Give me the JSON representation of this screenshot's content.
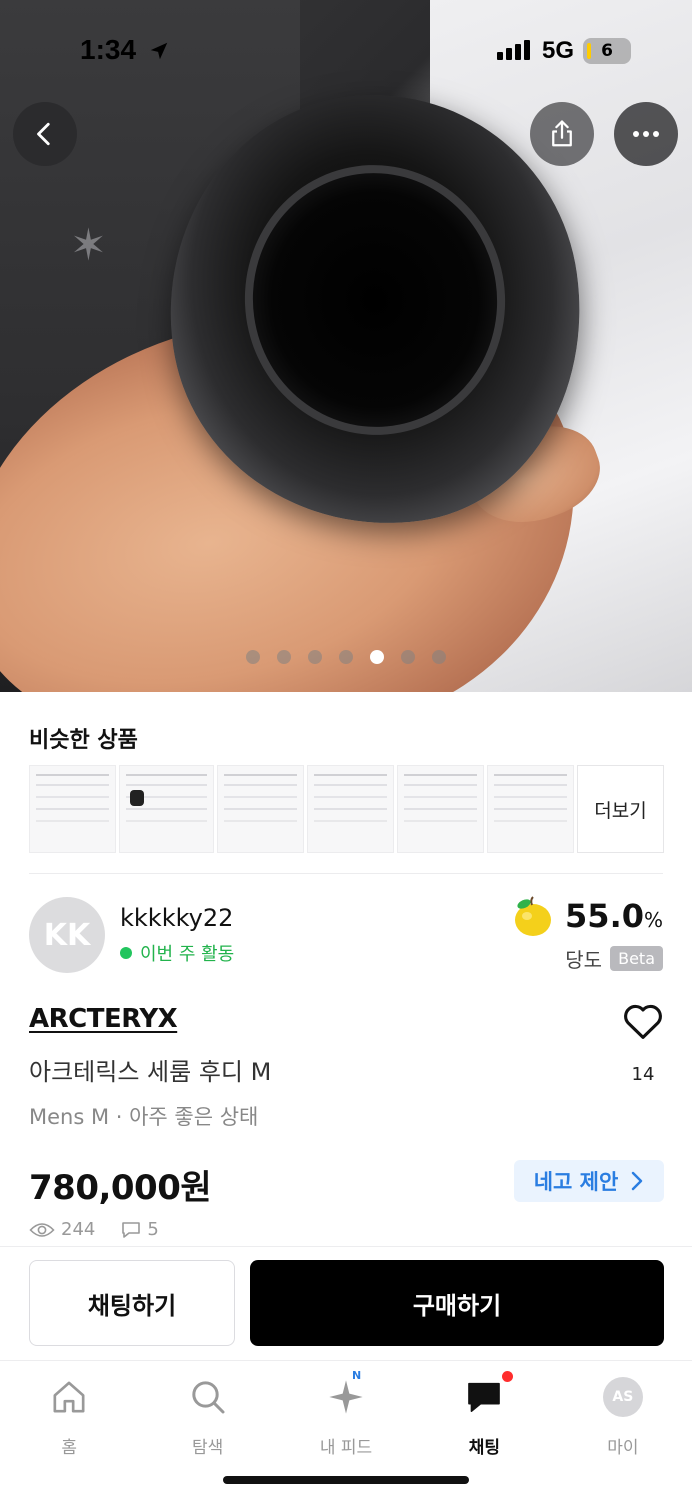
{
  "status_bar": {
    "time": "1:34",
    "network": "5G",
    "battery": "6"
  },
  "photo": {
    "total": 7,
    "active_index": 4
  },
  "similar": {
    "title": "비슷한 상품",
    "more_label": "더보기"
  },
  "seller": {
    "initials": "KK",
    "name": "kkkkky22",
    "activity": "이번 주 활동",
    "sugar_value": "55.0",
    "sugar_unit": "%",
    "sugar_label": "당도",
    "beta": "Beta"
  },
  "product": {
    "brand": "ARCTERYX",
    "title": "아크테릭스 세룸 후디 M",
    "meta": "Mens M · 아주 좋은 상태",
    "likes": "14",
    "price": "780,000원",
    "offer_label": "네고 제안",
    "views": "244",
    "chats": "5"
  },
  "actions": {
    "chat_label": "채팅하기",
    "buy_label": "구매하기"
  },
  "tabbar": {
    "home": "홈",
    "search": "탐색",
    "feed": "내 피드",
    "feed_badge": "N",
    "chat": "채팅",
    "my": "마이",
    "my_initials": "AS"
  },
  "colors": {
    "accent_blue": "#2a7de1",
    "active_green": "#22c55e",
    "badge_red": "#ff2d2d"
  }
}
